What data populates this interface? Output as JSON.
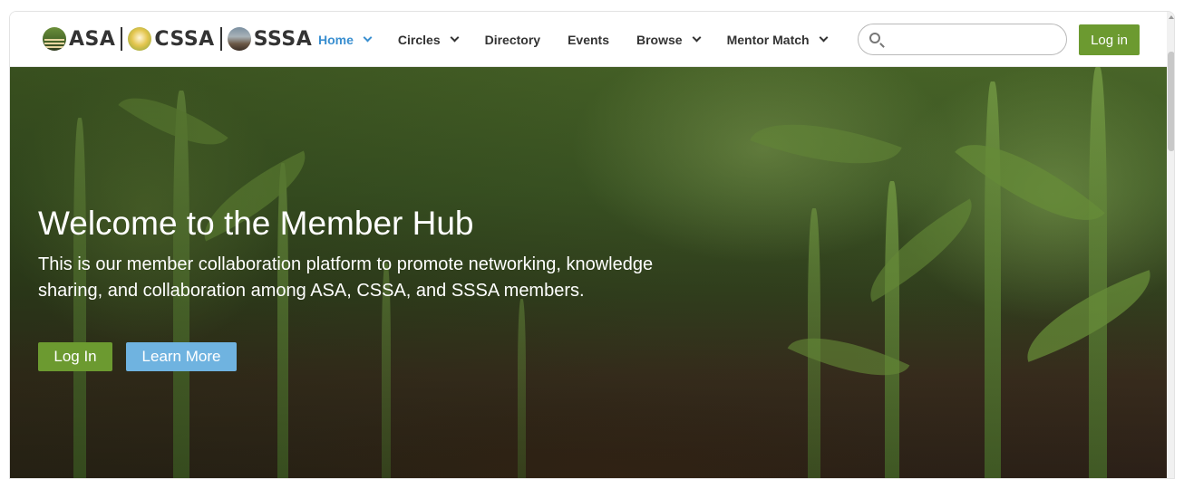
{
  "logo": {
    "parts": [
      "ASA",
      "CSSA",
      "SSSA"
    ]
  },
  "nav": {
    "items": [
      {
        "label": "Home",
        "dropdown": true,
        "active": true
      },
      {
        "label": "Circles",
        "dropdown": true
      },
      {
        "label": "Directory",
        "dropdown": false
      },
      {
        "label": "Events",
        "dropdown": false
      },
      {
        "label": "Browse",
        "dropdown": true
      },
      {
        "label": "Mentor Match",
        "dropdown": true
      }
    ]
  },
  "search": {
    "placeholder": "",
    "value": ""
  },
  "header": {
    "login_label": "Log in"
  },
  "hero": {
    "title": "Welcome to the Member Hub",
    "description": "This is our member collaboration platform to promote networking, knowledge sharing, and collaboration among ASA, CSSA, and SSSA members.",
    "login_label": "Log In",
    "learn_more_label": "Learn More"
  },
  "colors": {
    "accent_green": "#6c9a30",
    "accent_blue": "#6fb3e0",
    "active_nav": "#3a8fd0"
  },
  "icons": [
    "search-icon",
    "chevron-down-icon"
  ]
}
